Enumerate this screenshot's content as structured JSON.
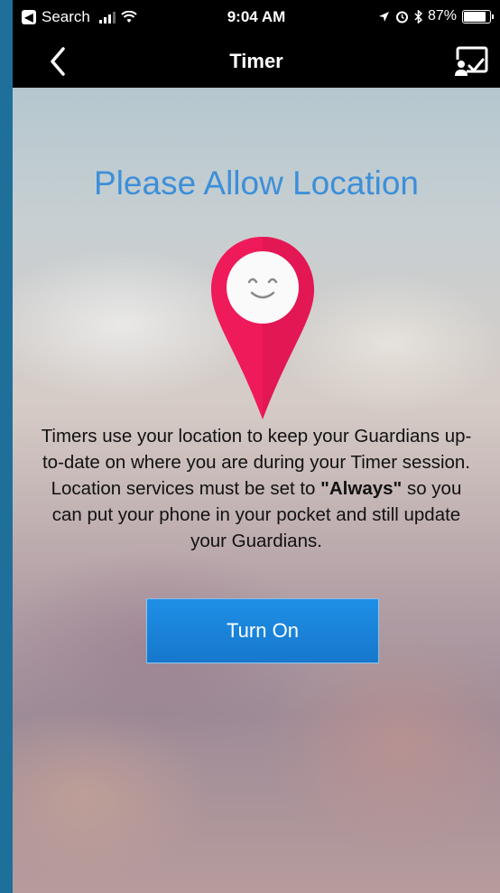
{
  "status_bar": {
    "back_app_label": "Search",
    "time": "9:04 AM",
    "battery": "87%",
    "battery_level": 0.87,
    "icons": [
      "back-arrow-icon",
      "signal-icon",
      "wifi-icon",
      "location-arrow-icon",
      "alarm-icon",
      "bluetooth-icon",
      "battery-icon"
    ]
  },
  "nav_bar": {
    "title": "Timer",
    "back_icon": "chevron-left-icon",
    "action_icon": "cast-screen-icon"
  },
  "content": {
    "headline": "Please Allow Location",
    "pin_icon": "location-pin-smiley-icon",
    "description_before": "Timers use your location to keep your Guardians up-to-date on where you are during your Timer session. Location services must be set to ",
    "description_emphasis": "\"Always\"",
    "description_after": " so you can put your phone in your pocket and still update your Guardians.",
    "button_label": "Turn On"
  },
  "colors": {
    "headline": "#3d8fd9",
    "pin": "#ef1a5a",
    "button": "#1a82d8",
    "bars": "#000000"
  }
}
